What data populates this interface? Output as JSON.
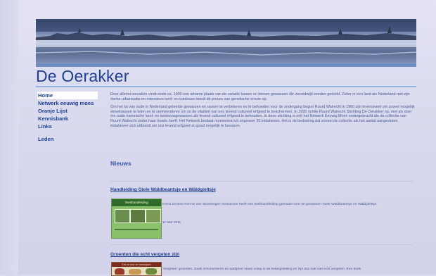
{
  "site": {
    "title": "De Oerakker"
  },
  "nav": {
    "items": [
      {
        "label": "Home"
      },
      {
        "label": "Netwerk eeuwig moes"
      },
      {
        "label": "Oranje Lijst"
      },
      {
        "label": "Kennisbank"
      },
      {
        "label": "Links"
      },
      {
        "label": "Leden"
      }
    ],
    "active_index": 0
  },
  "intro": {
    "p1": "Door allerlei oorzaken vindt sinds ca. 1900 een afname plaats van de variatie tussen en binnen gewassen die wereldwijd worden geteeld. Zeker in een land als Nederland met zijn sterke urbanisatie en intensieve land- en tuinbouw treedt dit proces van genetische erosie op.",
    "p2": "Om het lot van oude in Nederland geteelde gewassen en rassen te verbeteren en te behoeden voor de ondergang begon Ruurd Walrecht in 1960 zijn levenswerk om zoveel mogelijk streekrassen te telen en te vermeerderen om zo de vitaliteit van ons levend cultureel erfgoed te beschermen. In 1995 richtte Ruurd Walrecht Stichting De Oerakker op, met als doel om oude historische land- en tuinbouwgewassen als levend cultureel erfgoed te behouden. In deze stichting is ook het Netwerk Eeuwig Moes ondergebracht die de collectie van Ruurd Walrecht onder haar hoede heeft. Het Netwerk bestaat momenteel uit ongeveer 20 initiatieven. Het is de bedoeling dat zoveel de collectie als het aantal aangesloten initiatieven zich uitbreidt om ons levend erfgoed zo goed mogelijk te bewaren."
  },
  "news": {
    "heading": "Nieuws",
    "items": [
      {
        "title": "Handleiding Giele Wäldbeantsje en Wäldgieltsje",
        "thumb_caption": "Teelthandleiding",
        "text": "KIGO Groene Kennis van Streekeigen Gewassen heeft een teelthandleiding gemaakt voor de gewassen Giele Wäldbeantsje en Wäldgieltsje.",
        "date": "11 Mar 2011"
      },
      {
        "title": "Groenten die echt vergeten zijn",
        "thumb_caption": "Eet ze voor ze verdwijnen",
        "text": "'Vergeten' groenten, zoals schorseneren en aardpeer staan volop in de belangstelling en zijn dus ook niet echt vergeten. Een boek"
      }
    ]
  },
  "colors": {
    "link": "#1f3f8f",
    "text": "#4a5b8d",
    "page_bg": "#d9d9ef",
    "accent_bar": "#6f8fc4"
  }
}
